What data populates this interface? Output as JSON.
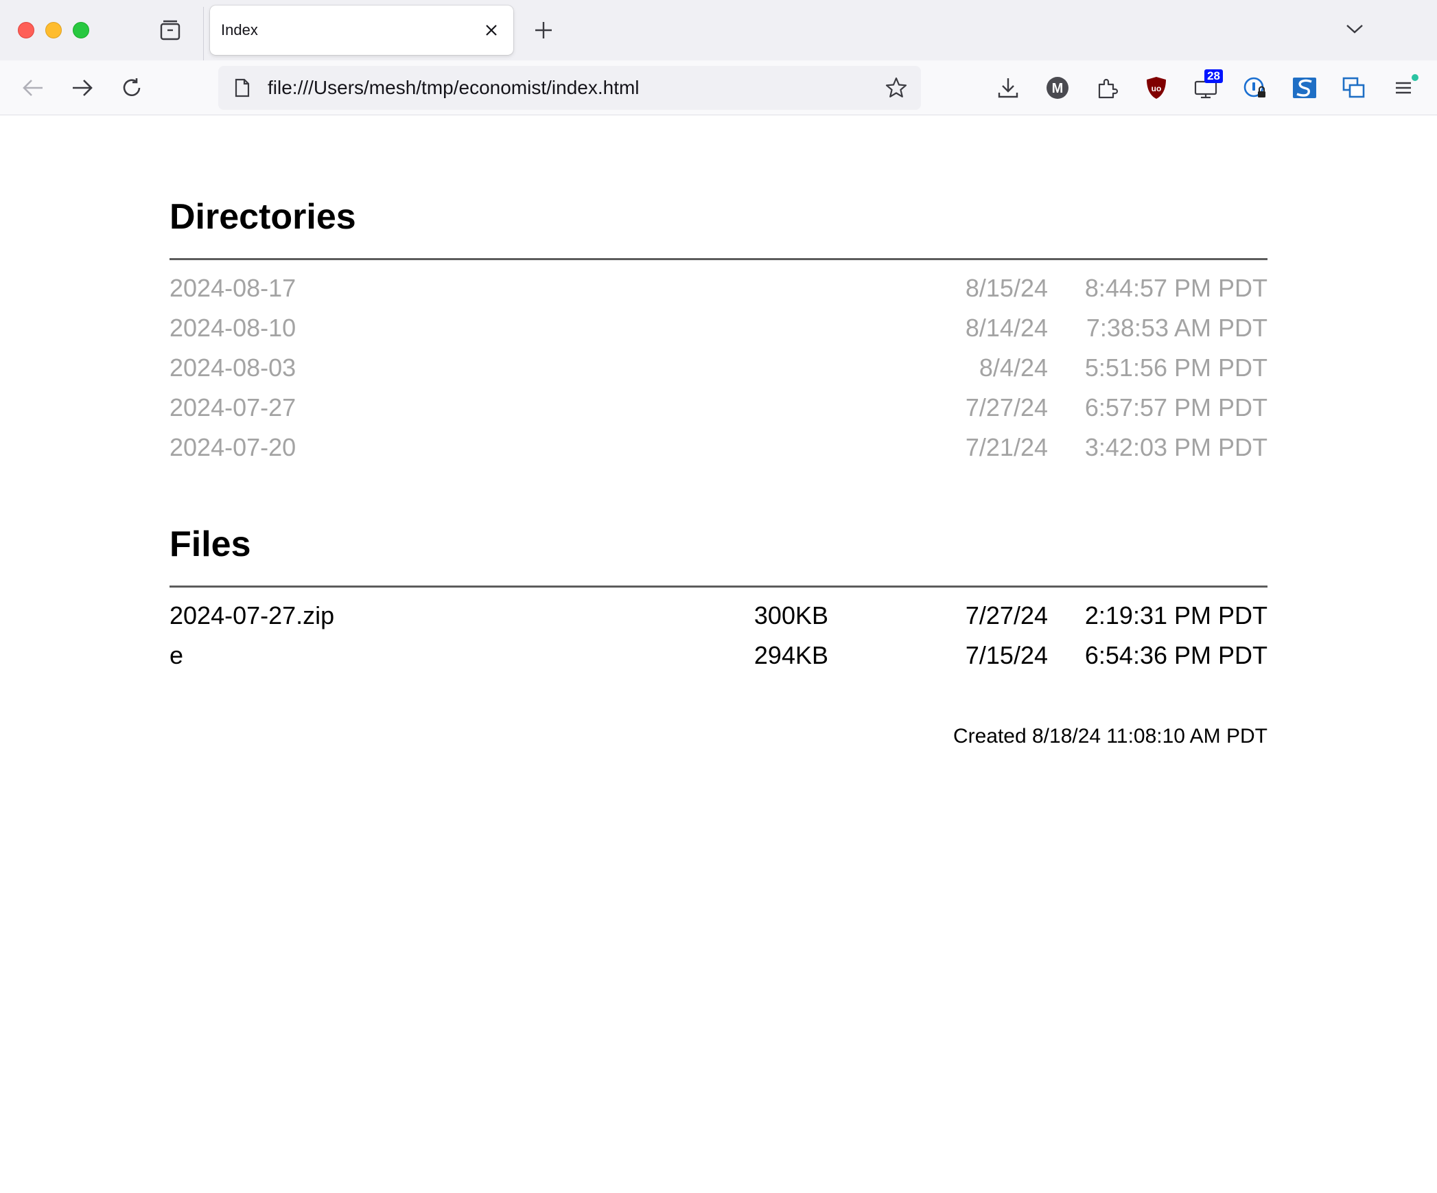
{
  "browser": {
    "tab": {
      "title": "Index"
    },
    "url": "file:///Users/mesh/tmp/economist/index.html",
    "toolbar": {
      "monitor_badge": "28",
      "mastodon_letter": "M",
      "ublock_letters": "uo"
    }
  },
  "page": {
    "directories": {
      "title": "Directories",
      "rows": [
        {
          "name": "2024-08-17",
          "date": "8/15/24",
          "time": "8:44:57 PM PDT"
        },
        {
          "name": "2024-08-10",
          "date": "8/14/24",
          "time": "7:38:53 AM PDT"
        },
        {
          "name": "2024-08-03",
          "date": "8/4/24",
          "time": "5:51:56 PM PDT"
        },
        {
          "name": "2024-07-27",
          "date": "7/27/24",
          "time": "6:57:57 PM PDT"
        },
        {
          "name": "2024-07-20",
          "date": "7/21/24",
          "time": "3:42:03 PM PDT"
        }
      ]
    },
    "files": {
      "title": "Files",
      "rows": [
        {
          "name": "2024-07-27.zip",
          "size": "300KB",
          "date": "7/27/24",
          "time": "2:19:31 PM PDT"
        },
        {
          "name": "e",
          "size": "294KB",
          "date": "7/15/24",
          "time": "6:54:36 PM PDT"
        }
      ]
    },
    "footer": "Created 8/18/24 11:08:10 AM PDT"
  },
  "colors": {
    "directory_text": "#a3a3a3",
    "file_text": "#000000",
    "rule": "#5c5c5c",
    "badge_bg": "#0014ff"
  }
}
